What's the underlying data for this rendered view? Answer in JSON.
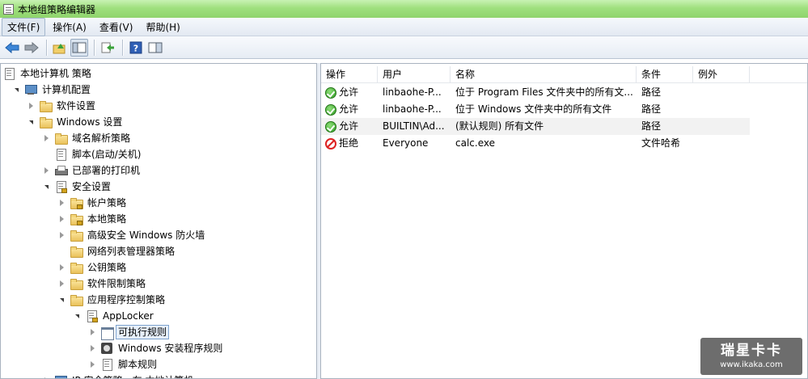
{
  "window": {
    "title": "本地组策略编辑器"
  },
  "menu": [
    {
      "label": "文件(F)",
      "active": true
    },
    {
      "label": "操作(A)"
    },
    {
      "label": "查看(V)"
    },
    {
      "label": "帮助(H)"
    }
  ],
  "toolbar": [
    "back-arrow-icon",
    "forward-arrow-icon",
    "up-folder-icon",
    "show-hide-tree-icon",
    "export-list-icon",
    "help-icon",
    "properties-icon"
  ],
  "tree": [
    {
      "label": "本地计算机 策略",
      "icon": "doc",
      "depth": 0,
      "exp": "none"
    },
    {
      "label": "计算机配置",
      "icon": "computer",
      "depth": 1,
      "exp": "open"
    },
    {
      "label": "软件设置",
      "icon": "folder",
      "depth": 2,
      "exp": "closed"
    },
    {
      "label": "Windows 设置",
      "icon": "folder",
      "depth": 2,
      "exp": "open"
    },
    {
      "label": "域名解析策略",
      "icon": "folder",
      "depth": 3,
      "exp": "closed"
    },
    {
      "label": "脚本(启动/关机)",
      "icon": "doc",
      "depth": 3,
      "exp": "none"
    },
    {
      "label": "已部署的打印机",
      "icon": "printer",
      "depth": 3,
      "exp": "closed"
    },
    {
      "label": "安全设置",
      "icon": "doc-lock",
      "depth": 3,
      "exp": "open"
    },
    {
      "label": "帐户策略",
      "icon": "folder-lock",
      "depth": 4,
      "exp": "closed"
    },
    {
      "label": "本地策略",
      "icon": "folder-lock",
      "depth": 4,
      "exp": "closed"
    },
    {
      "label": "高级安全 Windows 防火墙",
      "icon": "folder",
      "depth": 4,
      "exp": "closed"
    },
    {
      "label": "网络列表管理器策略",
      "icon": "folder",
      "depth": 4,
      "exp": "none"
    },
    {
      "label": "公钥策略",
      "icon": "folder",
      "depth": 4,
      "exp": "closed"
    },
    {
      "label": "软件限制策略",
      "icon": "folder",
      "depth": 4,
      "exp": "closed"
    },
    {
      "label": "应用程序控制策略",
      "icon": "folder",
      "depth": 4,
      "exp": "open"
    },
    {
      "label": "AppLocker",
      "icon": "doc-lock",
      "depth": 5,
      "exp": "open"
    },
    {
      "label": "可执行规则",
      "icon": "window",
      "depth": 6,
      "exp": "closed",
      "selected": true
    },
    {
      "label": "Windows 安装程序规则",
      "icon": "disc",
      "depth": 6,
      "exp": "closed"
    },
    {
      "label": "脚本规则",
      "icon": "doc",
      "depth": 6,
      "exp": "closed"
    },
    {
      "label": "IP 安全策略，在 本地计算机",
      "icon": "computer",
      "depth": 3,
      "exp": "closed"
    }
  ],
  "columns": [
    {
      "label": "操作",
      "w": 70
    },
    {
      "label": "用户",
      "w": 90
    },
    {
      "label": "名称",
      "w": 230
    },
    {
      "label": "条件",
      "w": 70
    },
    {
      "label": "例外",
      "w": 70
    }
  ],
  "rows": [
    {
      "action": "允许",
      "kind": "allow",
      "user": "linbaohe-P...",
      "name": "位于 Program Files 文件夹中的所有文...",
      "condition": "路径",
      "exception": ""
    },
    {
      "action": "允许",
      "kind": "allow",
      "user": "linbaohe-P...",
      "name": "位于 Windows 文件夹中的所有文件",
      "condition": "路径",
      "exception": ""
    },
    {
      "action": "允许",
      "kind": "allow",
      "user": "BUILTIN\\Ad...",
      "name": "(默认规则) 所有文件",
      "condition": "路径",
      "exception": "",
      "highlight": true
    },
    {
      "action": "拒绝",
      "kind": "deny",
      "user": "Everyone",
      "name": "calc.exe",
      "condition": "文件哈希",
      "exception": ""
    }
  ],
  "watermark": {
    "main": "瑞星卡卡",
    "sub": "www.ikaka.com"
  }
}
